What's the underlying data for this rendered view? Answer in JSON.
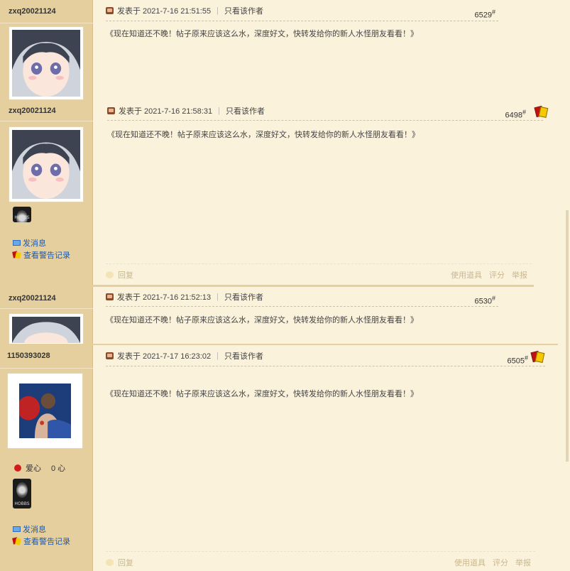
{
  "ui": {
    "reply_label": "回复",
    "use_tool_label": "使用道具",
    "rate_label": "评分",
    "report_label": "举报",
    "only_author_label": "只看该作者",
    "sep": "|",
    "floor_mark": "#",
    "send_msg_label": "发消息",
    "view_warn_label": "查看警告记录",
    "medal_text": "HOBBS",
    "love_label": "爱心",
    "love_value": "0 心"
  },
  "posts": [
    {
      "username": "zxq20021124",
      "posted": "发表于 2021-7-16 21:51:55",
      "floor": "6529",
      "content": "《现在知道还不晚！帖子原来应该这么水，深度好文，快转发给你的新人水怪朋友看看！》"
    },
    {
      "username": "zxq20021124",
      "posted": "发表于 2021-7-16 21:58:31",
      "floor": "6498",
      "content": "《现在知道还不晚！帖子原来应该这么水，深度好文，快转发给你的新人水怪朋友看看！》"
    },
    {
      "username": "zxq20021124",
      "posted": "发表于 2021-7-16 21:52:13",
      "floor": "6530",
      "content": "《现在知道还不晚！帖子原来应该这么水，深度好文，快转发给你的新人水怪朋友看看！》"
    },
    {
      "username": "1150393028",
      "posted": "发表于 2021-7-17 16:23:02",
      "floor": "6505",
      "content": "《现在知道还不晚！帖子原来应该这么水，深度好文，快转发给你的新人水怪朋友看看！》"
    }
  ]
}
